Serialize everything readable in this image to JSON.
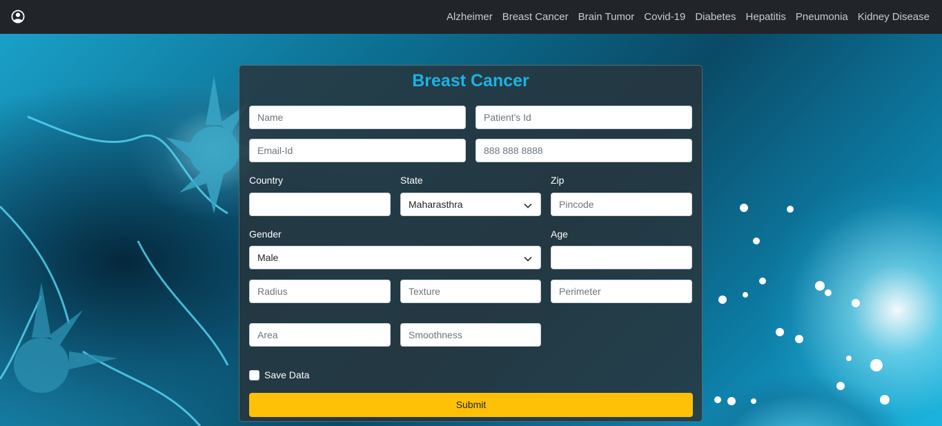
{
  "navbar": {
    "icon": "user-circle-icon",
    "links": [
      "Alzheimer",
      "Breast Cancer",
      "Brain Tumor",
      "Covid-19",
      "Diabetes",
      "Hepatitis",
      "Pneumonia",
      "Kidney Disease"
    ]
  },
  "form": {
    "title": "Breast Cancer",
    "title_color": "#1bb3e3",
    "name_placeholder": "Name",
    "patient_id_placeholder": "Patient's Id",
    "email_placeholder": "Email-Id",
    "phone_placeholder": "888 888 8888",
    "country_label": "Country",
    "country_value": "",
    "state_label": "State",
    "state_value": "Maharasthra",
    "zip_label": "Zip",
    "zip_placeholder": "Pincode",
    "gender_label": "Gender",
    "gender_value": "Male",
    "age_label": "Age",
    "age_value": "",
    "radius_placeholder": "Radius",
    "texture_placeholder": "Texture",
    "perimeter_placeholder": "Perimeter",
    "area_placeholder": "Area",
    "smoothness_placeholder": "Smoothness",
    "save_data_label": "Save Data",
    "save_data_checked": false,
    "submit_label": "Submit",
    "submit_color": "#ffc107"
  }
}
